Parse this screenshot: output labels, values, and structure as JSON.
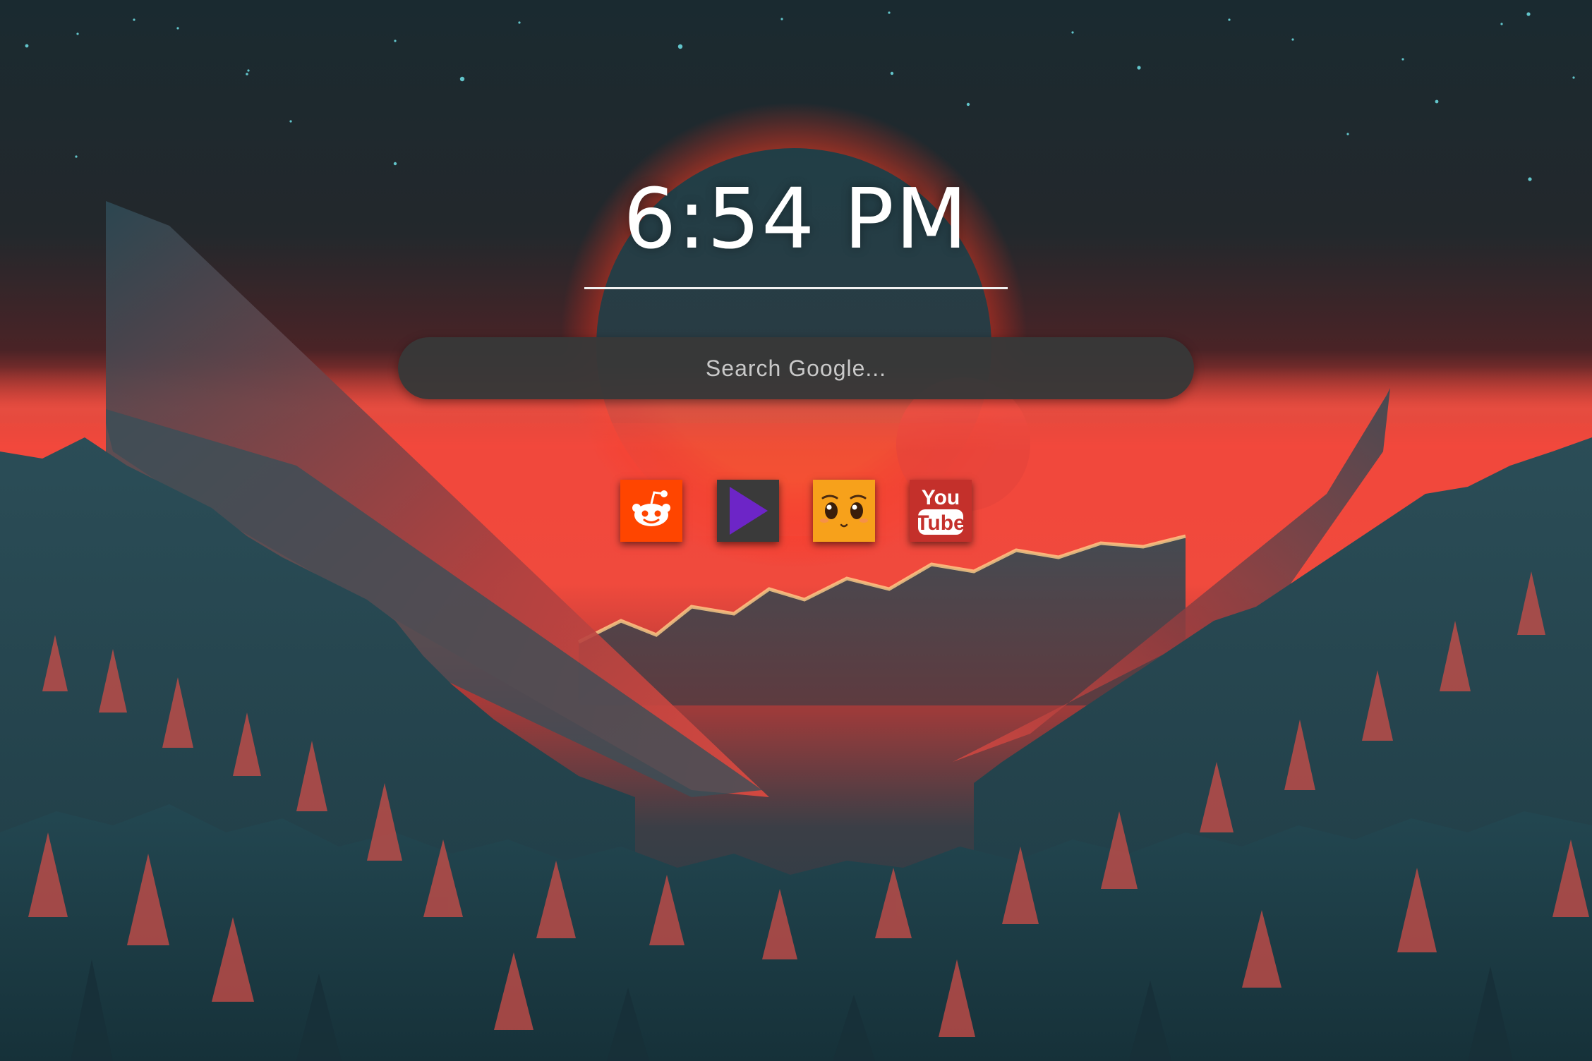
{
  "clock": {
    "time": "6:54 PM"
  },
  "search": {
    "placeholder": "Search Google..."
  },
  "shortcuts": [
    {
      "name": "Reddit",
      "icon": "reddit-alien-icon",
      "color": "#ff4500"
    },
    {
      "name": "Twitch",
      "icon": "play-triangle-icon",
      "color": "#6d25c7"
    },
    {
      "name": "Anime face",
      "icon": "anime-face-icon",
      "color": "#f7a11b"
    },
    {
      "name": "YouTube",
      "icon": "youtube-logo-icon",
      "color": "#c4302b",
      "logo_text": [
        "You",
        "Tube"
      ]
    }
  ],
  "theme": {
    "sky_dark": "#1e2a30",
    "sunset_red": "#f0443a",
    "forest_teal": "#1f4852",
    "tree_highlight": "#d9524a"
  }
}
